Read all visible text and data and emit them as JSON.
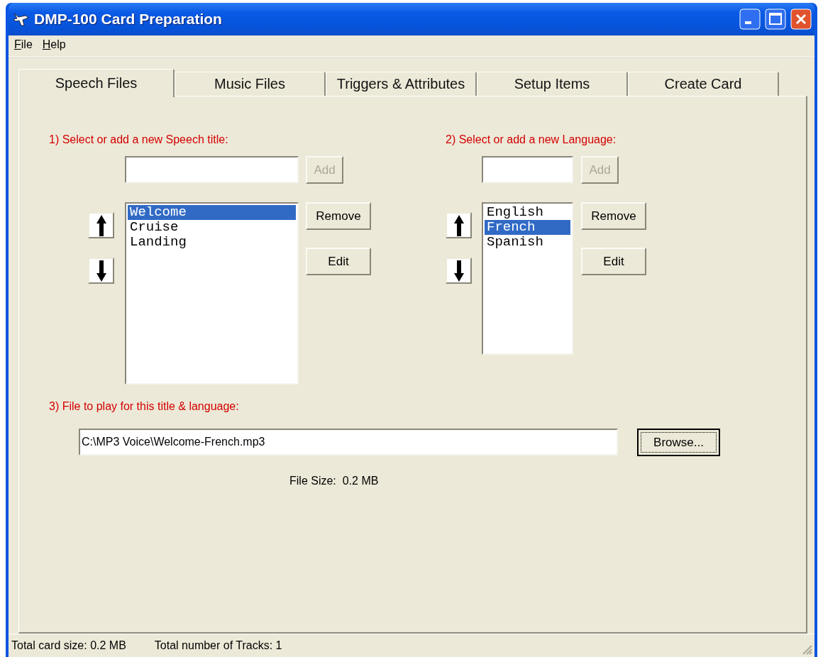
{
  "window": {
    "title": "DMP-100 Card Preparation"
  },
  "menu": [
    "File",
    "Help"
  ],
  "tabs": [
    {
      "label": "Speech Files",
      "selected": true
    },
    {
      "label": "Music Files",
      "selected": false
    },
    {
      "label": "Triggers & Attributes",
      "selected": false
    },
    {
      "label": "Setup Items",
      "selected": false
    },
    {
      "label": "Create Card",
      "selected": false
    }
  ],
  "sections": [
    {
      "label": "1) Select or add a new Speech title:",
      "add_button": {
        "label": "Add",
        "disabled": true
      },
      "items": [
        {
          "text": "Welcome",
          "selected": true
        },
        {
          "text": "Cruise",
          "selected": false
        },
        {
          "text": "Landing",
          "selected": false
        }
      ],
      "remove_button": "Remove",
      "edit_button": "Edit"
    },
    {
      "label": "2) Select or add a new Language:",
      "add_button": {
        "label": "Add",
        "disabled": true
      },
      "items": [
        {
          "text": "English",
          "selected": false
        },
        {
          "text": "French",
          "selected": true
        },
        {
          "text": "Spanish",
          "selected": false
        }
      ],
      "remove_button": "Remove",
      "edit_button": "Edit"
    }
  ],
  "file": {
    "label": "3) File to play for this title & language:",
    "value": "C:\\MP3 Voice\\Welcome-French.mp3",
    "browse_button": {
      "label": "Browse...",
      "focused": true
    },
    "size": "File Size:  0.2 MB"
  },
  "status_bar": [
    "Total card size: 0.2 MB",
    "Total number of Tracks: 1"
  ]
}
